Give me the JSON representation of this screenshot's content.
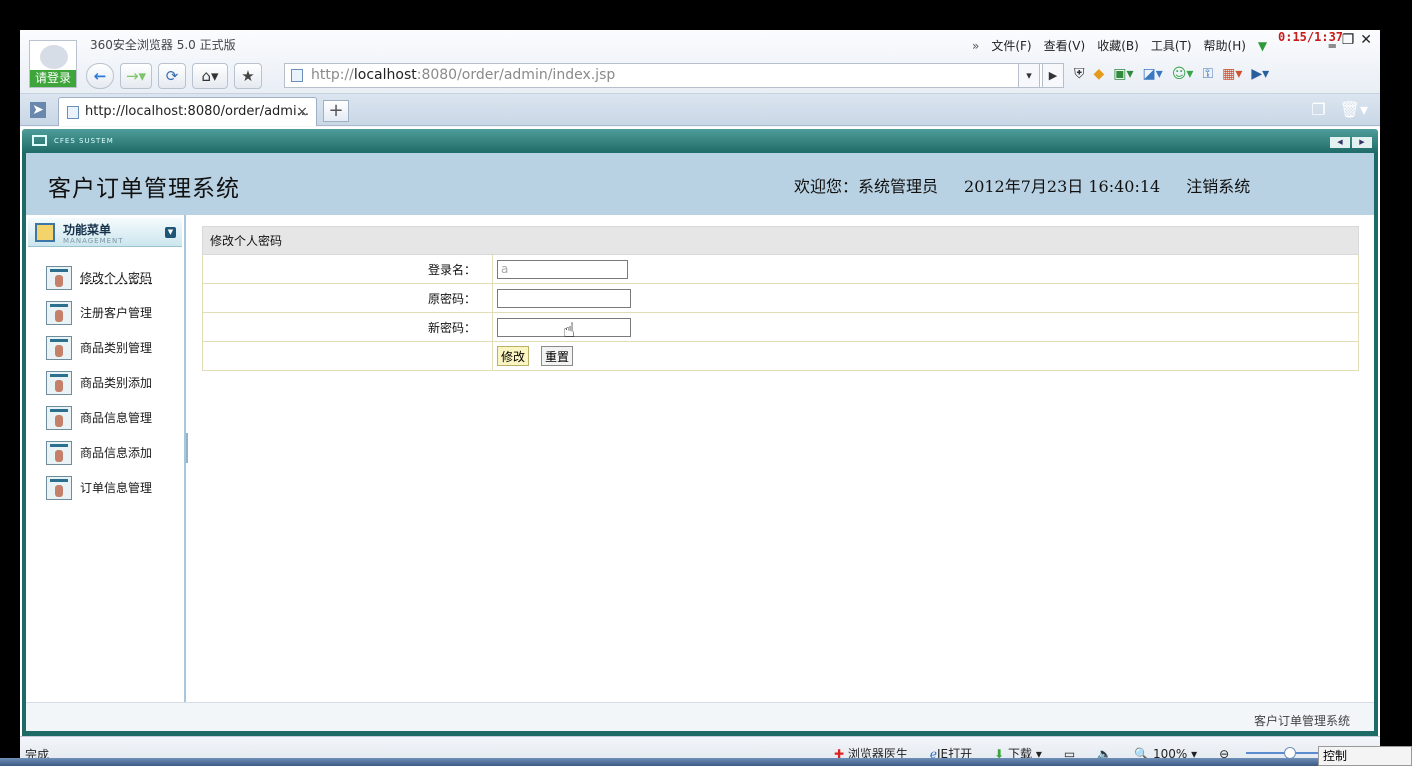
{
  "browser": {
    "app_title": "360安全浏览器 5.0 正式版",
    "login_label": "请登录",
    "menus": [
      "文件(F)",
      "查看(V)",
      "收藏(B)",
      "工具(T)",
      "帮助(H)"
    ],
    "menu_chevron": "»",
    "timer": "0:15/1:37",
    "address_prefix": "http://",
    "address_host": "localhost",
    "address_rest": ":8080/order/admin/index.jsp",
    "tab_title": "http://localhost:8080/order/admi...",
    "tab_close": "×",
    "new_tab": "+"
  },
  "system": {
    "frame_label": "CFES SUSTEM",
    "title": "客户订单管理系统",
    "welcome": "欢迎您：系统管理员",
    "datetime": "2012年7月23日  16:40:14",
    "logout": "注销系统"
  },
  "sidebar": {
    "title": "功能菜单",
    "subtitle": "MANAGEMENT",
    "items": [
      {
        "label": "修改个人密码"
      },
      {
        "label": "注册客户管理"
      },
      {
        "label": "商品类别管理"
      },
      {
        "label": "商品类别添加"
      },
      {
        "label": "商品信息管理"
      },
      {
        "label": "商品信息添加"
      },
      {
        "label": "订单信息管理"
      }
    ]
  },
  "form": {
    "caption": "修改个人密码",
    "login_name_label": "登录名：",
    "login_name_value": "a",
    "old_password_label": "原密码：",
    "new_password_label": "新密码：",
    "submit_label": "修改",
    "reset_label": "重置"
  },
  "page_footer": "客户订单管理系统",
  "status": {
    "done": "完成",
    "doctor": "浏览器医生",
    "ie_open": "IE打开",
    "download": "下载",
    "zoom": "100%",
    "control": "控制"
  }
}
